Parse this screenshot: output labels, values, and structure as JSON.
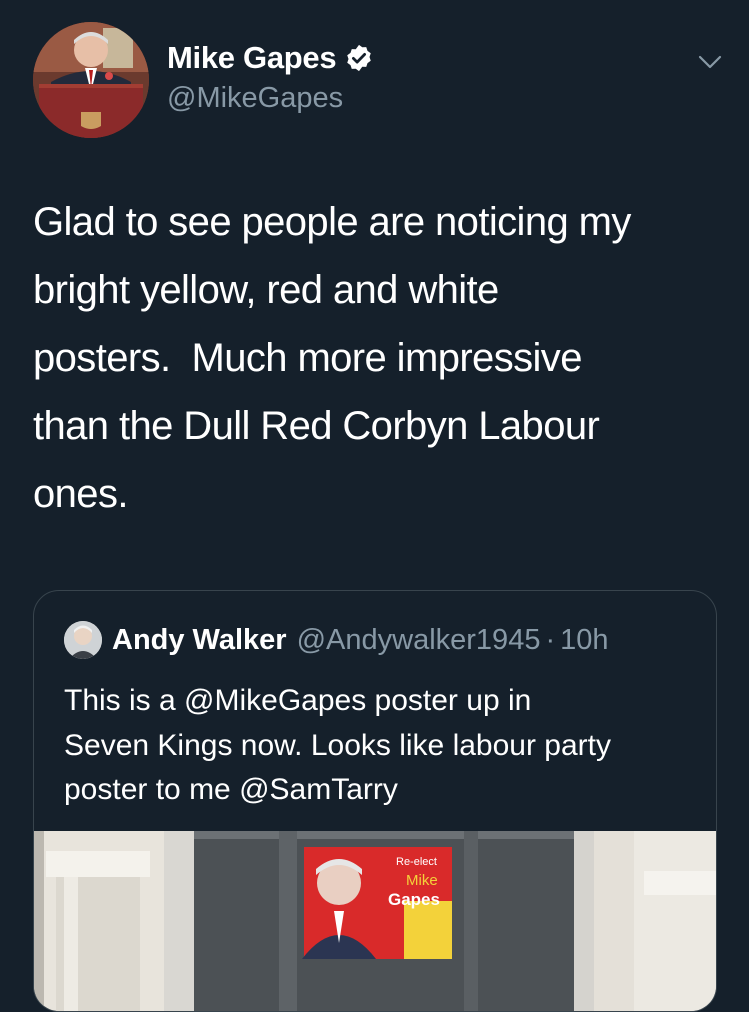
{
  "tweet": {
    "author_name": "Mike Gapes",
    "author_handle": "@MikeGapes",
    "verified_icon": "verified-badge-icon",
    "menu_icon": "chevron-down-icon",
    "text": "Glad to see people are noticing my\nbright yellow, red and white\nposters.  Much more impressive\nthan the Dull Red Corbyn Labour\nones."
  },
  "quoted": {
    "author_name": "Andy Walker",
    "author_handle": "@Andywalker1945",
    "separator": "·",
    "time": "10h",
    "text": "This is a @MikeGapes poster up in\nSeven Kings now. Looks like labour party\nposter to me @SamTarry",
    "poster": {
      "line1": "Re-elect",
      "line2": "Mike",
      "line3": "Gapes"
    }
  },
  "colors": {
    "background": "#15202b",
    "secondary_text": "#8899a6",
    "border": "#38444d"
  }
}
